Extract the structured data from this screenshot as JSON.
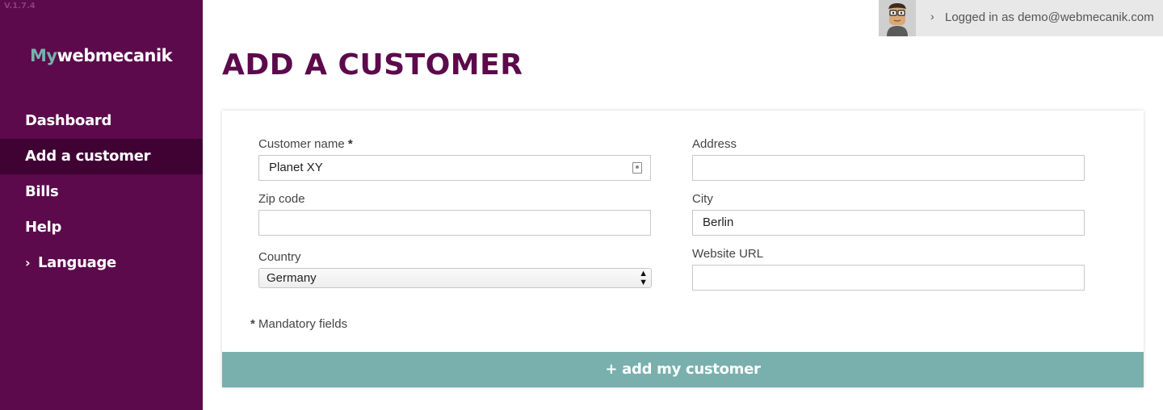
{
  "version": "V.1.7.4",
  "logo": {
    "my": "My",
    "rest": "webmecanik"
  },
  "nav": [
    {
      "label": "Dashboard"
    },
    {
      "label": "Add a customer"
    },
    {
      "label": "Bills"
    },
    {
      "label": "Help"
    },
    {
      "label": "Language"
    }
  ],
  "user": {
    "text": "Logged in as demo@webmecanik.com",
    "icon": "avatar"
  },
  "page": {
    "title": "ADD A CUSTOMER"
  },
  "form": {
    "customer_name": {
      "label": "Customer name",
      "required_mark": "*",
      "value": "Planet XY"
    },
    "address": {
      "label": "Address",
      "value": ""
    },
    "zip": {
      "label": "Zip code",
      "value": ""
    },
    "city": {
      "label": "City",
      "value": "Berlin"
    },
    "country": {
      "label": "Country",
      "value": "Germany"
    },
    "website": {
      "label": "Website URL",
      "value": ""
    },
    "mandatory_mark": "*",
    "mandatory_note": "Mandatory fields",
    "submit_label": "+ add my customer"
  },
  "colors": {
    "sidebar": "#5c0a4c",
    "sidebar_active": "#3f0233",
    "accent": "#79b0ad",
    "title": "#5c0a4c"
  }
}
